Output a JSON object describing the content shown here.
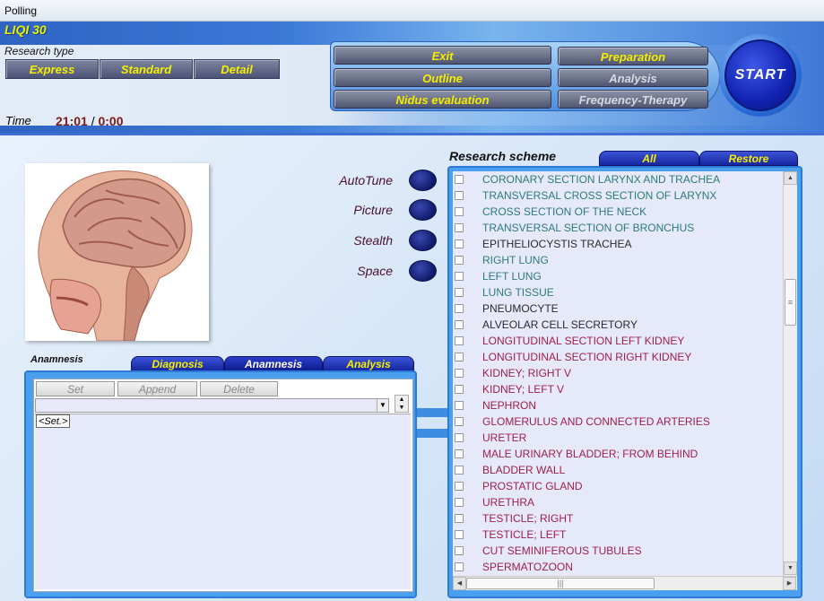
{
  "window": {
    "title": "Polling"
  },
  "app": {
    "name": "LIQI 30"
  },
  "research_type": {
    "label": "Research type",
    "buttons": [
      "Express",
      "Standard",
      "Detail"
    ]
  },
  "time": {
    "label": "Time",
    "elapsed": "21:01",
    "separator": "/",
    "remaining": "0:00"
  },
  "controls": {
    "exit": "Exit",
    "outline": "Outline",
    "nidus": "Nidus evaluation",
    "preparation": "Preparation",
    "analysis": "Analysis",
    "frequency_therapy": "Frequency-Therapy",
    "start": "START"
  },
  "options": [
    "AutoTune",
    "Picture",
    "Stealth",
    "Space"
  ],
  "anamnesis": {
    "label": "Anamnesis",
    "tabs": [
      "Diagnosis",
      "Anamnesis",
      "Analysis"
    ],
    "active_tab": "Anamnesis",
    "buttons": {
      "set": "Set",
      "append": "Append",
      "delete": "Delete"
    },
    "set_tag": "<Set.>"
  },
  "scheme": {
    "title": "Research scheme",
    "tabs": {
      "all": "All",
      "restore": "Restore"
    },
    "colors": {
      "teal": "#2c7a7e",
      "dark": "#2a2a2a",
      "crimson": "#9e1f4a"
    },
    "items": [
      {
        "text": "CORONARY SECTION LARYNX AND TRACHEA",
        "color": "#2c7a7e"
      },
      {
        "text": "TRANSVERSAL CROSS SECTION OF LARYNX",
        "color": "#2c7a7e"
      },
      {
        "text": "CROSS SECTION OF THE NECK",
        "color": "#2c7a7e"
      },
      {
        "text": "TRANSVERSAL SECTION OF BRONCHUS",
        "color": "#2c7a7e"
      },
      {
        "text": "EPITHELIOCYSTIS TRACHEA",
        "color": "#2a2a2a"
      },
      {
        "text": "RIGHT LUNG",
        "color": "#2c7a7e"
      },
      {
        "text": "LEFT LUNG",
        "color": "#2c7a7e"
      },
      {
        "text": "LUNG TISSUE",
        "color": "#2c7a7e"
      },
      {
        "text": "PNEUMOCYTE",
        "color": "#2a2a2a"
      },
      {
        "text": "ALVEOLAR CELL SECRETORY",
        "color": "#2a2a2a"
      },
      {
        "text": "LONGITUDINAL SECTION LEFT KIDNEY",
        "color": "#9e1f4a"
      },
      {
        "text": "LONGITUDINAL SECTION RIGHT KIDNEY",
        "color": "#9e1f4a"
      },
      {
        "text": "KIDNEY; RIGHT  V",
        "color": "#9e1f4a"
      },
      {
        "text": "KIDNEY; LEFT  V",
        "color": "#9e1f4a"
      },
      {
        "text": "NEPHRON",
        "color": "#9e1f4a"
      },
      {
        "text": "GLOMERULUS AND CONNECTED ARTERIES",
        "color": "#9e1f4a"
      },
      {
        "text": "URETER",
        "color": "#9e1f4a"
      },
      {
        "text": "MALE  URINARY  BLADDER;  FROM BEHIND",
        "color": "#9e1f4a"
      },
      {
        "text": "BLADDER WALL",
        "color": "#9e1f4a"
      },
      {
        "text": "PROSTATIC GLAND",
        "color": "#9e1f4a"
      },
      {
        "text": "URETHRA",
        "color": "#9e1f4a"
      },
      {
        "text": "TESTICLE; RIGHT",
        "color": "#9e1f4a"
      },
      {
        "text": "TESTICLE;  LEFT",
        "color": "#9e1f4a"
      },
      {
        "text": "CUT SEMINIFEROUS TUBULES",
        "color": "#9e1f4a"
      },
      {
        "text": "SPERMATOZOON",
        "color": "#9e1f4a"
      }
    ]
  }
}
